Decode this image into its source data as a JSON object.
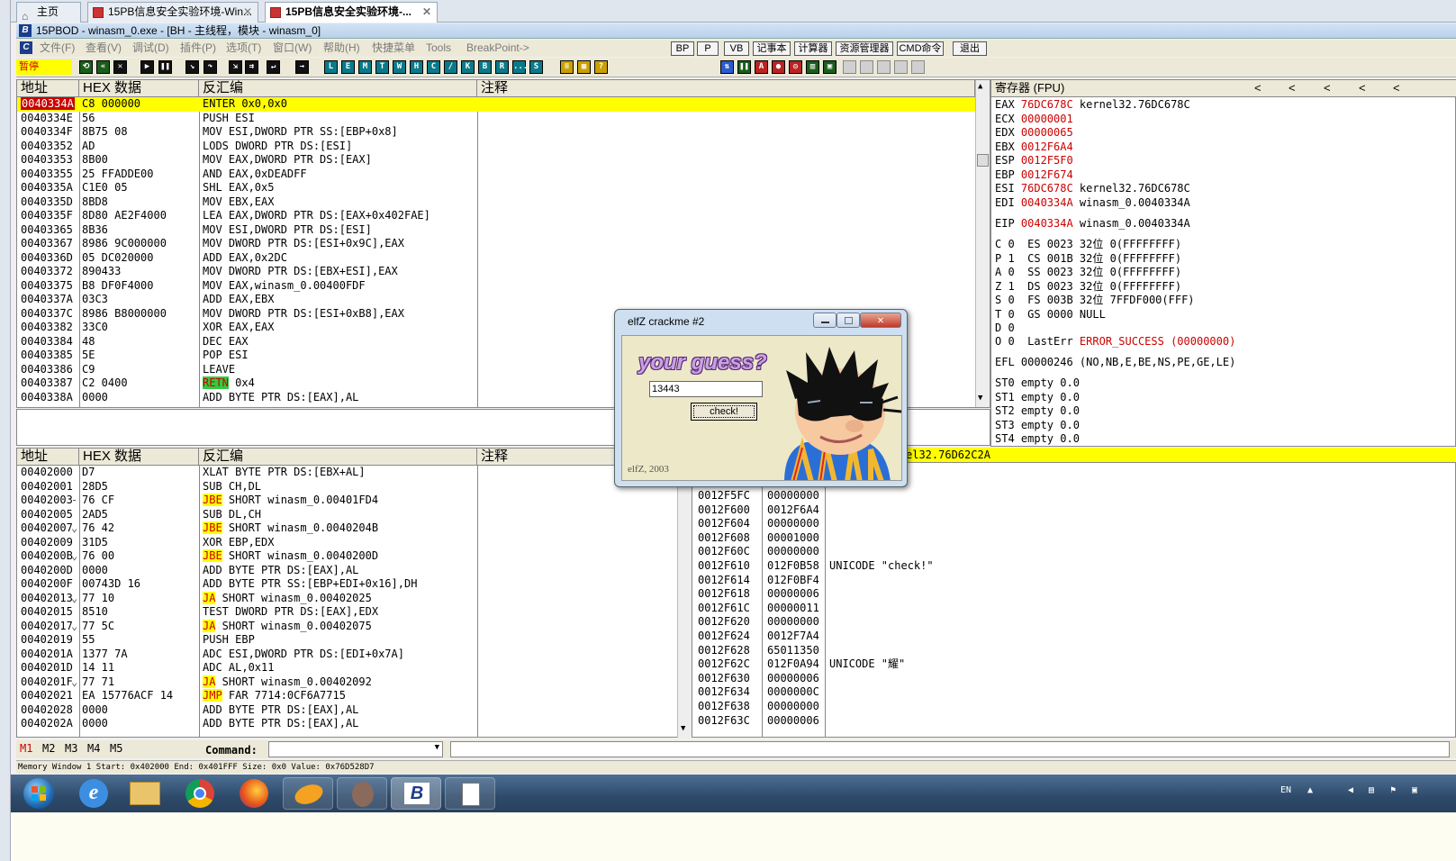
{
  "browser_tabs": [
    {
      "label": "主页"
    },
    {
      "label": "15PB信息安全实验环境-Win..."
    },
    {
      "label": "15PB信息安全实验环境-..."
    }
  ],
  "window_title": "15PBOD - winasm_0.exe - [BH - 主线程，模块 - winasm_0]",
  "menu": [
    "文件(F)",
    "查看(V)",
    "调试(D)",
    "插件(P)",
    "选项(T)",
    "窗口(W)",
    "帮助(H)",
    "快捷菜单",
    "Tools",
    "BreakPoint->"
  ],
  "menu_buttons": [
    "BP",
    "P",
    "VB",
    "记事本",
    "计算器",
    "资源管理器",
    "CMD命令",
    "退出"
  ],
  "status_state": "暂停",
  "toolbar_letters": [
    "L",
    "E",
    "M",
    "T",
    "W",
    "H",
    "C",
    "/",
    "K",
    "B",
    "R",
    "...",
    "S"
  ],
  "cpu_pane": {
    "headers": [
      "地址",
      "HEX 数据",
      "反汇编",
      "注释"
    ],
    "rows": [
      {
        "addr": "0040334A",
        "hex": "C8 000000",
        "dis": "ENTER 0x0,0x0",
        "current": true
      },
      {
        "addr": "0040334E",
        "hex": "56",
        "dis": "PUSH ESI"
      },
      {
        "addr": "0040334F",
        "hex": "8B75 08",
        "dis": "MOV ESI,DWORD PTR SS:[EBP+0x8]"
      },
      {
        "addr": "00403352",
        "hex": "AD",
        "dis": "LODS DWORD PTR DS:[ESI]"
      },
      {
        "addr": "00403353",
        "hex": "8B00",
        "dis": "MOV EAX,DWORD PTR DS:[EAX]"
      },
      {
        "addr": "00403355",
        "hex": "25 FFADDE00",
        "dis": "AND EAX,0xDEADFF"
      },
      {
        "addr": "0040335A",
        "hex": "C1E0 05",
        "dis": "SHL EAX,0x5"
      },
      {
        "addr": "0040335D",
        "hex": "8BD8",
        "dis": "MOV EBX,EAX"
      },
      {
        "addr": "0040335F",
        "hex": "8D80 AE2F4000",
        "dis": "LEA EAX,DWORD PTR DS:[EAX+0x402FAE]"
      },
      {
        "addr": "00403365",
        "hex": "8B36",
        "dis": "MOV ESI,DWORD PTR DS:[ESI]"
      },
      {
        "addr": "00403367",
        "hex": "8986 9C000000",
        "dis": "MOV DWORD PTR DS:[ESI+0x9C],EAX"
      },
      {
        "addr": "0040336D",
        "hex": "05 DC020000",
        "dis": "ADD EAX,0x2DC"
      },
      {
        "addr": "00403372",
        "hex": "890433",
        "dis": "MOV DWORD PTR DS:[EBX+ESI],EAX"
      },
      {
        "addr": "00403375",
        "hex": "B8 DF0F4000",
        "dis": "MOV EAX,winasm_0.00400FDF"
      },
      {
        "addr": "0040337A",
        "hex": "03C3",
        "dis": "ADD EAX,EBX"
      },
      {
        "addr": "0040337C",
        "hex": "8986 B8000000",
        "dis": "MOV DWORD PTR DS:[ESI+0xB8],EAX"
      },
      {
        "addr": "00403382",
        "hex": "33C0",
        "dis": "XOR EAX,EAX"
      },
      {
        "addr": "00403384",
        "hex": "48",
        "dis": "DEC EAX"
      },
      {
        "addr": "00403385",
        "hex": "5E",
        "dis": "POP ESI"
      },
      {
        "addr": "00403386",
        "hex": "C9",
        "dis": "LEAVE"
      },
      {
        "addr": "00403387",
        "hex": "C2 0400",
        "mn": "RETN",
        "dis": " 0x4",
        "mnstyle": "green"
      },
      {
        "addr": "0040338A",
        "hex": "0000",
        "dis": "ADD BYTE PTR DS:[EAX],AL"
      }
    ]
  },
  "registers": {
    "title": "寄存器 (FPU)",
    "nav": [
      "<",
      "<",
      "<",
      "<",
      "<"
    ],
    "general": [
      {
        "name": "EAX",
        "value": "76DC678C",
        "note": "kernel32.76DC678C"
      },
      {
        "name": "ECX",
        "value": "00000001",
        "note": ""
      },
      {
        "name": "EDX",
        "value": "00000065",
        "note": ""
      },
      {
        "name": "EBX",
        "value": "0012F6A4",
        "note": ""
      },
      {
        "name": "ESP",
        "value": "0012F5F0",
        "note": ""
      },
      {
        "name": "EBP",
        "value": "0012F674",
        "note": ""
      },
      {
        "name": "ESI",
        "value": "76DC678C",
        "note": "kernel32.76DC678C"
      },
      {
        "name": "EDI",
        "value": "0040334A",
        "note": "winasm_0.0040334A"
      }
    ],
    "eip": {
      "name": "EIP",
      "value": "0040334A",
      "note": "winasm_0.0040334A"
    },
    "flags": [
      "C 0  ES 0023 32位 0(FFFFFFFF)",
      "P 1  CS 001B 32位 0(FFFFFFFF)",
      "A 0  SS 0023 32位 0(FFFFFFFF)",
      "Z 1  DS 0023 32位 0(FFFFFFFF)",
      "S 0  FS 003B 32位 7FFDF000(FFF)",
      "T 0  GS 0000 NULL",
      "D 0"
    ],
    "lasterr": {
      "prefix": "O 0  LastErr ",
      "value": "ERROR_SUCCESS (00000000)"
    },
    "efl": "EFL 00000246 (NO,NB,E,BE,NS,PE,GE,LE)",
    "fpu": [
      "ST0 empty 0.0",
      "ST1 empty 0.0",
      "ST2 empty 0.0",
      "ST3 empty 0.0",
      "ST4 empty 0.0"
    ]
  },
  "stack_header_partial": "el32.76D62C2A",
  "dump_pane": {
    "headers": [
      "地址",
      "HEX 数据",
      "反汇编",
      "注释"
    ],
    "rows": [
      {
        "addr": "00402000",
        "hex": "D7",
        "mn": "",
        "dis": "XLAT BYTE PTR DS:[EBX+AL]"
      },
      {
        "addr": "00402001",
        "hex": "28D5",
        "mn": "",
        "dis": "SUB CH,DL"
      },
      {
        "addr": "00402003",
        "mark": "-",
        "hex": "76 CF",
        "mn": "JBE",
        "dis": " SHORT winasm_0.00401FD4"
      },
      {
        "addr": "00402005",
        "hex": "2AD5",
        "mn": "",
        "dis": "SUB DL,CH"
      },
      {
        "addr": "00402007",
        "mark": "⌄",
        "hex": "76 42",
        "mn": "JBE",
        "dis": " SHORT winasm_0.0040204B"
      },
      {
        "addr": "00402009",
        "hex": "31D5",
        "mn": "",
        "dis": "XOR EBP,EDX"
      },
      {
        "addr": "0040200B",
        "mark": "⌄",
        "hex": "76 00",
        "mn": "JBE",
        "dis": " SHORT winasm_0.0040200D"
      },
      {
        "addr": "0040200D",
        "hex": "0000",
        "mn": "",
        "dis": "ADD BYTE PTR DS:[EAX],AL"
      },
      {
        "addr": "0040200F",
        "hex": "00743D 16",
        "mn": "",
        "dis": "ADD BYTE PTR SS:[EBP+EDI+0x16],DH"
      },
      {
        "addr": "00402013",
        "mark": "⌄",
        "hex": "77 10",
        "mn": "JA",
        "dis": " SHORT winasm_0.00402025"
      },
      {
        "addr": "00402015",
        "hex": "8510",
        "mn": "",
        "dis": "TEST DWORD PTR DS:[EAX],EDX"
      },
      {
        "addr": "00402017",
        "mark": "⌄",
        "hex": "77 5C",
        "mn": "JA",
        "dis": " SHORT winasm_0.00402075"
      },
      {
        "addr": "00402019",
        "hex": "55",
        "mn": "",
        "dis": "PUSH EBP"
      },
      {
        "addr": "0040201A",
        "hex": "1377 7A",
        "mn": "",
        "dis": "ADC ESI,DWORD PTR DS:[EDI+0x7A]"
      },
      {
        "addr": "0040201D",
        "hex": "14 11",
        "mn": "",
        "dis": "ADC AL,0x11"
      },
      {
        "addr": "0040201F",
        "mark": "⌄",
        "hex": "77 71",
        "mn": "JA",
        "dis": " SHORT winasm_0.00402092"
      },
      {
        "addr": "00402021",
        "hex": "EA 15776ACF 14",
        "mn": "JMP",
        "dis": " FAR 7714:0CF6A7715"
      },
      {
        "addr": "00402028",
        "hex": "0000",
        "mn": "",
        "dis": "ADD BYTE PTR DS:[EAX],AL"
      },
      {
        "addr": "0040202A",
        "hex": "0000",
        "mn": "",
        "dis": "ADD BYTE PTR DS:[EAX],AL"
      }
    ]
  },
  "stack": [
    {
      "addr": "0012F5FC",
      "val": "00000000",
      "note": ""
    },
    {
      "addr": "0012F600",
      "val": "0012F6A4",
      "note": ""
    },
    {
      "addr": "0012F604",
      "val": "00000000",
      "note": ""
    },
    {
      "addr": "0012F608",
      "val": "00001000",
      "note": ""
    },
    {
      "addr": "0012F60C",
      "val": "00000000",
      "note": ""
    },
    {
      "addr": "0012F610",
      "val": "012F0B58",
      "note": "UNICODE \"check!\""
    },
    {
      "addr": "0012F614",
      "val": "012F0BF4",
      "note": ""
    },
    {
      "addr": "0012F618",
      "val": "00000006",
      "note": ""
    },
    {
      "addr": "0012F61C",
      "val": "00000011",
      "note": ""
    },
    {
      "addr": "0012F620",
      "val": "00000000",
      "note": ""
    },
    {
      "addr": "0012F624",
      "val": "0012F7A4",
      "note": ""
    },
    {
      "addr": "0012F628",
      "val": "65011350",
      "note": ""
    },
    {
      "addr": "0012F62C",
      "val": "012F0A94",
      "note": "UNICODE \"耀\""
    },
    {
      "addr": "0012F630",
      "val": "00000006",
      "note": ""
    },
    {
      "addr": "0012F634",
      "val": "0000000C",
      "note": ""
    },
    {
      "addr": "0012F638",
      "val": "00000000",
      "note": ""
    },
    {
      "addr": "0012F63C",
      "val": "00000006",
      "note": ""
    }
  ],
  "dialog": {
    "title": "elfZ crackme #2",
    "heading": "your guess?",
    "input_value": "13443",
    "button": "check!",
    "footer": "elfZ, 2003"
  },
  "command_bar": {
    "tabs": [
      "M1",
      "M2",
      "M3",
      "M4",
      "M5"
    ],
    "label": "Command:"
  },
  "status_line": "Memory Window 1  Start: 0x402000  End: 0x401FFF  Size: 0x0 Value: 0x76D528D7",
  "tray": {
    "lang": "EN"
  },
  "taskbar_apps": [
    "start-orb-icon",
    "ie-icon",
    "explorer-icon",
    "chrome-icon",
    "firefox-icon",
    "folder-icon",
    "avatar-icon",
    "15pb-od-icon",
    "notepad-icon"
  ]
}
